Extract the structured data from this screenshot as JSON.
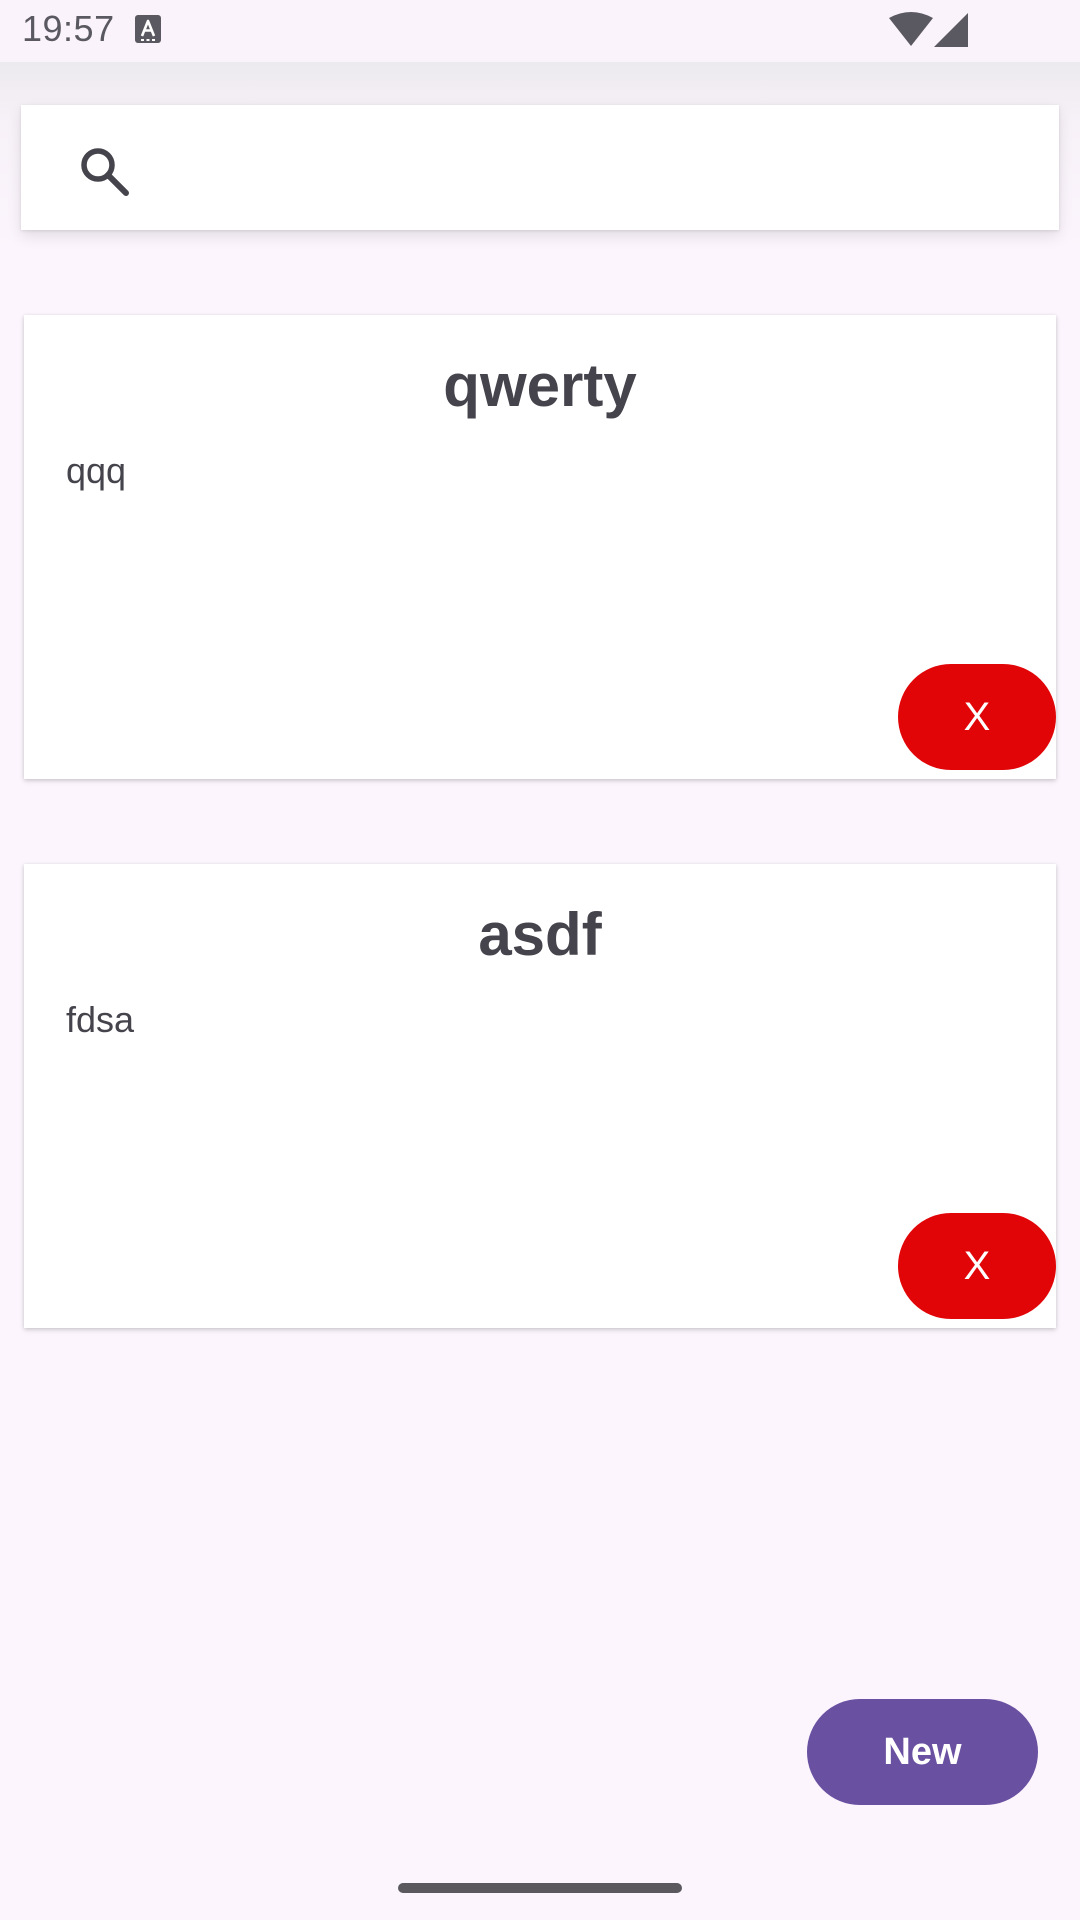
{
  "status_bar": {
    "time": "19:57",
    "icons": [
      "keyboard-a-icon",
      "wifi-icon",
      "cell-signal-icon"
    ]
  },
  "search": {
    "value": "",
    "placeholder": "",
    "icon": "search-icon"
  },
  "notes": [
    {
      "title": "qwerty",
      "body": "qqq",
      "delete_label": "X"
    },
    {
      "title": "asdf",
      "body": "fdsa",
      "delete_label": "X"
    }
  ],
  "new_button": {
    "label": "New"
  },
  "colors": {
    "background": "#fcf5fd",
    "delete_button": "#e20508",
    "new_button": "#6950a1",
    "text": "#45434b"
  }
}
